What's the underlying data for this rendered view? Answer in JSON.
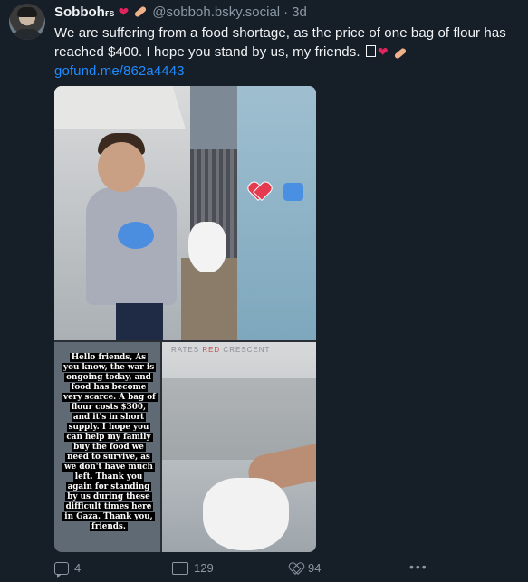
{
  "post": {
    "author_name": "Sobboh",
    "author_name_suffix": "ғѕ",
    "handle": "@sobboh.bsky.social",
    "separator": "·",
    "time": "3d",
    "text": "We are suffering from a food shortage, as the price of one bag of flour has reached $400. I hope you stand by us, my friends.",
    "link": "gofund.me/862a4443"
  },
  "image_caption": "Hello friends, As you know, the war is ongoing today, and food has become very scarce. A bag of flour costs $300, and it's in short supply. I hope you can help my family buy the food we need to survive, as we don't have much left. Thank you again for standing by us during these difficult times here in Gaza. Thank you, friends.",
  "image_stamp": {
    "part1": "RATES ",
    "part2": "RED",
    "part3": " CRESCENT"
  },
  "actions": {
    "replies": "4",
    "reposts": "129",
    "likes": "94",
    "more": "•••"
  },
  "colors": {
    "background": "#161e27",
    "link": "#208bfe",
    "muted": "#8b98a5"
  },
  "icons": [
    "reply-icon",
    "repost-icon",
    "like-icon",
    "more-icon",
    "heart-emoji",
    "bandage-emoji"
  ]
}
